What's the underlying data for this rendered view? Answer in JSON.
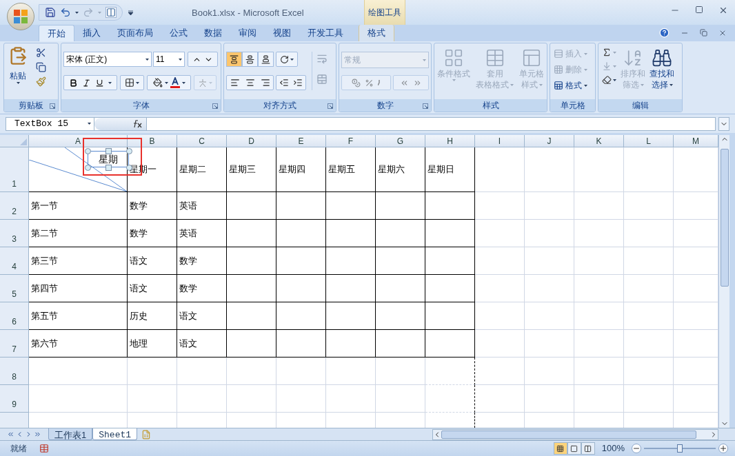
{
  "window": {
    "title": "Book1.xlsx - Microsoft Excel",
    "context_label": "绘图工具"
  },
  "ribbon_tabs": [
    {
      "label": "开始",
      "selected": true,
      "kind": "main"
    },
    {
      "label": "插入",
      "selected": false,
      "kind": "main"
    },
    {
      "label": "页面布局",
      "selected": false,
      "kind": "main"
    },
    {
      "label": "公式",
      "selected": false,
      "kind": "main"
    },
    {
      "label": "数据",
      "selected": false,
      "kind": "main"
    },
    {
      "label": "审阅",
      "selected": false,
      "kind": "main"
    },
    {
      "label": "视图",
      "selected": false,
      "kind": "main"
    },
    {
      "label": "开发工具",
      "selected": false,
      "kind": "main"
    },
    {
      "label": "格式",
      "selected": false,
      "kind": "context"
    }
  ],
  "groups": [
    {
      "label": "剪贴板",
      "launcher": true
    },
    {
      "label": "字体",
      "launcher": true
    },
    {
      "label": "对齐方式",
      "launcher": true
    },
    {
      "label": "数字",
      "launcher": true
    },
    {
      "label": "样式",
      "launcher": false
    },
    {
      "label": "单元格",
      "launcher": false
    },
    {
      "label": "编辑",
      "launcher": false
    }
  ],
  "paste_label": "粘贴",
  "font": {
    "name": "宋体 (正文)",
    "size": "11"
  },
  "vertical_align": [
    {
      "selected": true
    },
    {
      "selected": false
    },
    {
      "selected": false
    }
  ],
  "number_format": {
    "value": "常规",
    "disabled": true
  },
  "styles": [
    {
      "lines": [
        "条件格式"
      ],
      "disabled": true
    },
    {
      "lines": [
        "套用",
        "表格格式"
      ],
      "disabled": true
    },
    {
      "lines": [
        "单元格",
        "样式"
      ],
      "disabled": true
    }
  ],
  "cells": [
    {
      "label": "插入",
      "disabled": true
    },
    {
      "label": "删除",
      "disabled": true
    },
    {
      "label": "格式",
      "disabled": false
    }
  ],
  "editing": [
    {
      "lines": [
        "排序和",
        "筛选"
      ],
      "disabled": true
    },
    {
      "lines": [
        "查找和",
        "选择"
      ],
      "disabled": false
    }
  ],
  "name_box": "TextBox 15",
  "columns": [
    "A",
    "B",
    "C",
    "D",
    "E",
    "F",
    "G",
    "H",
    "I",
    "J",
    "K",
    "L",
    "M"
  ],
  "row_headers": [
    "1",
    "2",
    "3",
    "4",
    "5",
    "6",
    "7",
    "8",
    "9"
  ],
  "weekday_headers": [
    "星期一",
    "星期二",
    "星期三",
    "星期四",
    "星期五",
    "星期六",
    "星期日"
  ],
  "lessons": [
    [
      "第一节",
      "数学",
      "英语"
    ],
    [
      "第二节",
      "数学",
      "英语"
    ],
    [
      "第三节",
      "语文",
      "数学"
    ],
    [
      "第四节",
      "语文",
      "数学"
    ],
    [
      "第五节",
      "历史",
      "语文"
    ],
    [
      "第六节",
      "地理",
      "语文"
    ]
  ],
  "text_box": {
    "text": "星期",
    "selected": true,
    "highlighted": true
  },
  "sheet_tabs": [
    {
      "label": "工作表1",
      "selected": false
    },
    {
      "label": "Sheet1",
      "selected": true
    }
  ],
  "status": {
    "text": "就绪",
    "zoom": "100%",
    "level": 0.5
  },
  "views": [
    {
      "selected": true
    },
    {
      "selected": false
    },
    {
      "selected": false
    }
  ]
}
